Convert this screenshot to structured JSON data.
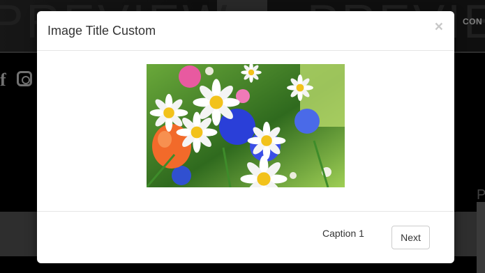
{
  "background": {
    "watermark_left": "PREVIEW",
    "watermark_right": "PREVIEW",
    "nav_item": "CON",
    "right_letter": "P",
    "social_facebook": "f"
  },
  "modal": {
    "title": "Image Title Custom",
    "close_label": "×",
    "image_alt": "Flower bouquet",
    "caption": "Caption 1",
    "next_label": "Next"
  },
  "colors": {
    "modal_bg": "#ffffff",
    "page_bg": "#000000",
    "border": "#e5e5e5"
  }
}
